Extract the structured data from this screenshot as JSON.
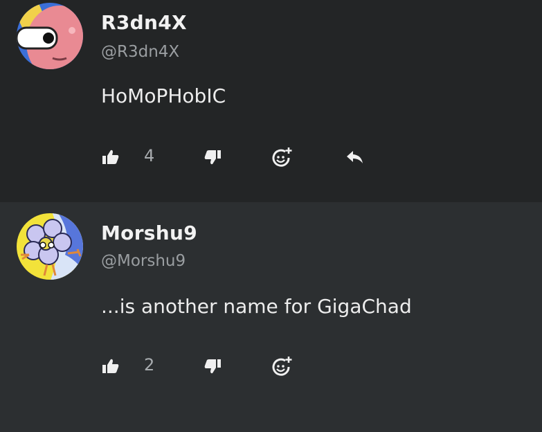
{
  "comments": [
    {
      "name": "R3dn4X",
      "handle": "@R3dn4X",
      "text": "HoMoPHobIC",
      "likes": "4",
      "has_reply": true,
      "avatar_colors": {
        "bg": "#e98a93",
        "accent": "#3b6fd8",
        "eye": "#ffffff"
      }
    },
    {
      "name": "Morshu9",
      "handle": "@Morshu9",
      "text": "...is another name for GigaChad",
      "likes": "2",
      "has_reply": false,
      "avatar_colors": {
        "bg": "#f2e23a",
        "accent": "#3f63d6",
        "flower": "#c9c6f0"
      }
    }
  ],
  "icons": {
    "like": "thumbs-up-icon",
    "dislike": "thumbs-down-icon",
    "react": "add-reaction-icon",
    "reply": "reply-icon"
  }
}
